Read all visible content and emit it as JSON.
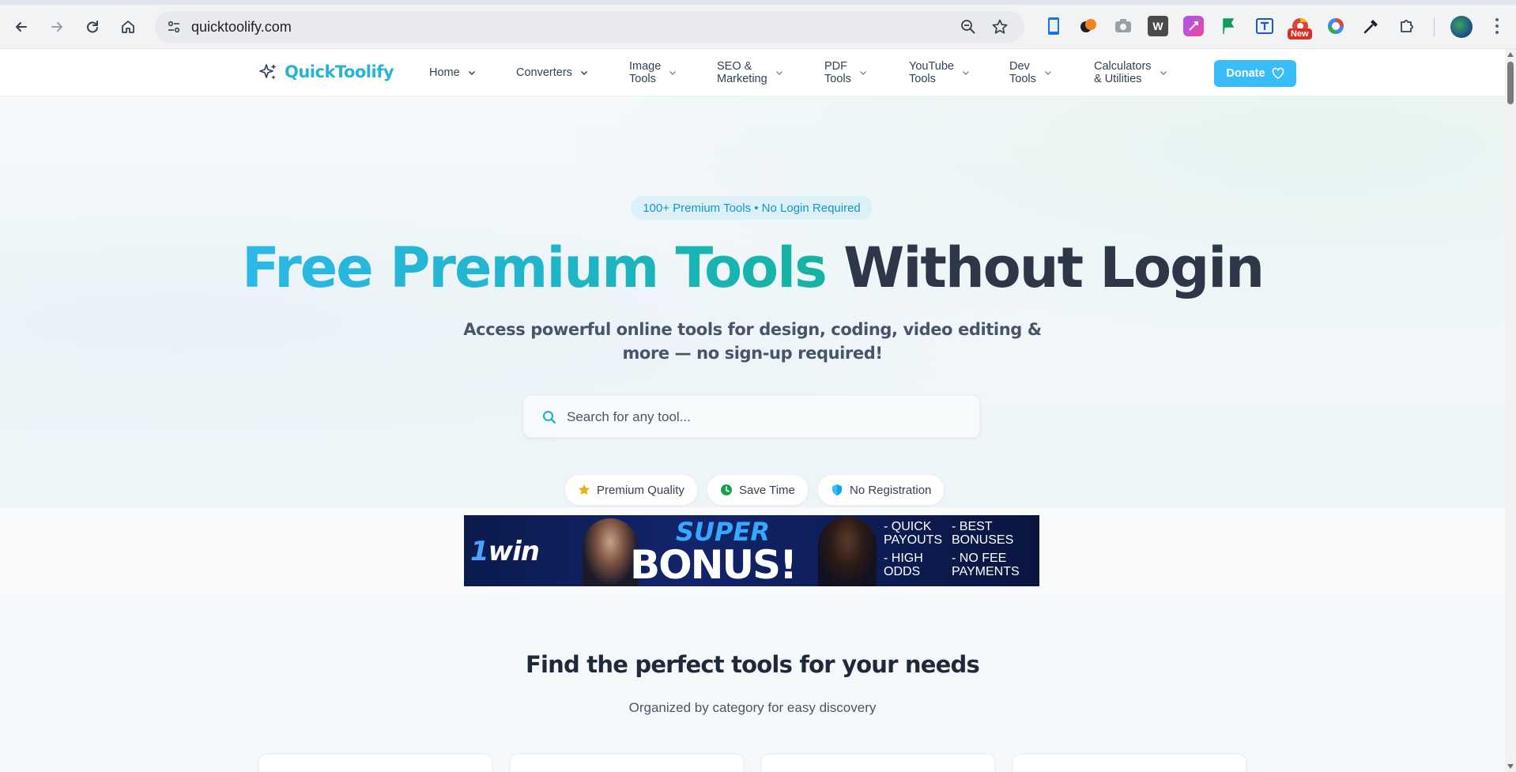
{
  "browser": {
    "url": "quicktoolify.com",
    "new_badge": "New",
    "extensions": [
      "phone-link-icon",
      "orange-bird-icon",
      "camera-icon",
      "word-icon",
      "purple-ext-icon",
      "green-flag-icon",
      "translate-icon",
      "chrome-new-icon",
      "color-wheel-icon",
      "eyedropper-icon",
      "puzzle-icon"
    ]
  },
  "site": {
    "logo": "QuickToolify",
    "nav": [
      {
        "label": "Home"
      },
      {
        "label": "Converters"
      },
      {
        "label": "Image\nTools"
      },
      {
        "label": "SEO &\nMarketing"
      },
      {
        "label": "PDF\nTools"
      },
      {
        "label": "YouTube\nTools"
      },
      {
        "label": "Dev\nTools"
      },
      {
        "label": "Calculators\n& Utilities"
      }
    ],
    "donate": "Donate"
  },
  "hero": {
    "badge": "100+ Premium Tools • No Login Required",
    "title_highlight": "Free Premium Tools",
    "title_rest": "Without Login",
    "subtitle": "Access powerful online tools for design, coding, video editing & more — no sign-up required!",
    "search_placeholder": "Search for any tool...",
    "features": [
      {
        "label": "Premium Quality",
        "icon": "star-icon"
      },
      {
        "label": "Save Time",
        "icon": "clock-icon"
      },
      {
        "label": "No Registration",
        "icon": "shield-icon"
      }
    ]
  },
  "ad": {
    "brand_prefix": "1",
    "brand": "win",
    "line1": "SUPER",
    "line2": "BONUS!",
    "b1": "- QUICK\n  PAYOUTS",
    "b2": "- HIGH\n  ODDS",
    "b3": "- BEST\n  BONUSES",
    "b4": "- NO FEE\n  PAYMENTS"
  },
  "section": {
    "title": "Find the perfect tools for your needs",
    "subtitle": "Organized by category for easy discovery"
  },
  "colors": {
    "brand": "#26b3d6",
    "donate": "#38bdf8",
    "title_dark": "#2d3748"
  }
}
